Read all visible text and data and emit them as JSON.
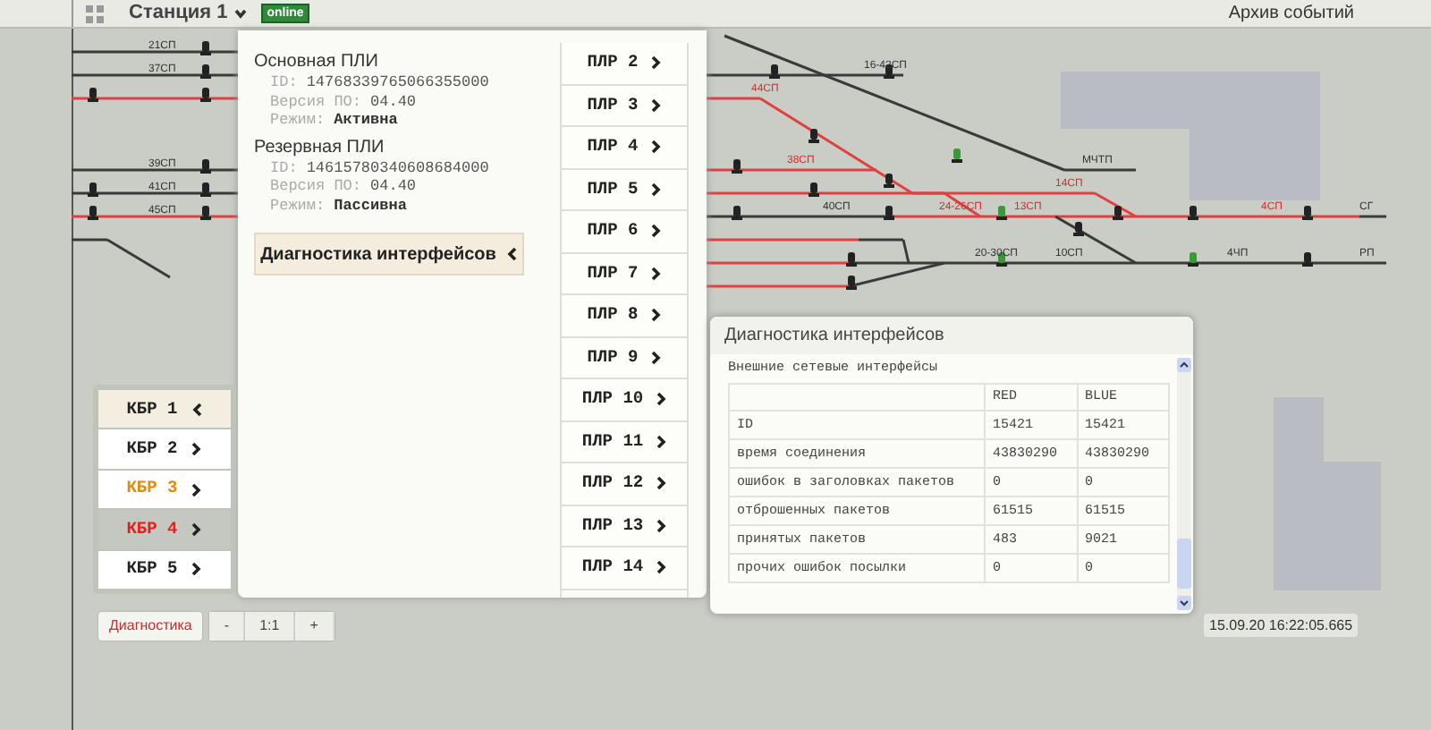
{
  "topbar": {
    "station": "Станция 1",
    "status": "online",
    "archive": "Архив событий"
  },
  "track_labels": [
    {
      "text": "21СП",
      "color": "#333333"
    },
    {
      "text": "37СП",
      "color": "#333333"
    },
    {
      "text": "39СП",
      "color": "#333333"
    },
    {
      "text": "41СП",
      "color": "#333333"
    },
    {
      "text": "45СП",
      "color": "#333333"
    },
    {
      "text": "44СП",
      "color": "#d03030"
    },
    {
      "text": "16-42СП",
      "color": "#333333"
    },
    {
      "text": "38СП",
      "color": "#d03030"
    },
    {
      "text": "МЧТП",
      "color": "#333333"
    },
    {
      "text": "14СП",
      "color": "#d03030"
    },
    {
      "text": "40СП",
      "color": "#333333"
    },
    {
      "text": "24-26СП",
      "color": "#d03030"
    },
    {
      "text": "13СП",
      "color": "#d03030"
    },
    {
      "text": "4СП",
      "color": "#d03030"
    },
    {
      "text": "СГ",
      "color": "#333333"
    },
    {
      "text": "20-30СП",
      "color": "#333333"
    },
    {
      "text": "10СП",
      "color": "#333333"
    },
    {
      "text": "4ЧП",
      "color": "#333333"
    },
    {
      "text": "РП",
      "color": "#333333"
    }
  ],
  "controller_panel": {
    "units": [
      {
        "title": "Основная ПЛИ",
        "id_label": "ID:",
        "id": "14768339765066355000",
        "version_label": "Версия ПО:",
        "version": "04.40",
        "mode_label": "Режим:",
        "mode": "Активна"
      },
      {
        "title": "Резервная ПЛИ",
        "id_label": "ID:",
        "id": "14615780340608684000",
        "version_label": "Версия ПО:",
        "version": "04.40",
        "mode_label": "Режим:",
        "mode": "Пассивна"
      }
    ],
    "diagnostics_button": {
      "label": "Диагностика интерфейсов",
      "expanded": true
    },
    "plr": [
      {
        "label": "ПЛР 2"
      },
      {
        "label": "ПЛР 3"
      },
      {
        "label": "ПЛР 4"
      },
      {
        "label": "ПЛР 5"
      },
      {
        "label": "ПЛР 6"
      },
      {
        "label": "ПЛР 7"
      },
      {
        "label": "ПЛР 8"
      },
      {
        "label": "ПЛР 9"
      },
      {
        "label": "ПЛР 10"
      },
      {
        "label": "ПЛР 11"
      },
      {
        "label": "ПЛР 12"
      },
      {
        "label": "ПЛР 13"
      },
      {
        "label": "ПЛР 14"
      }
    ]
  },
  "kbr": [
    {
      "label": "КБР 1",
      "selected": true,
      "shaded": false,
      "color": "#222222"
    },
    {
      "label": "КБР 2",
      "selected": false,
      "shaded": false,
      "color": "#222222"
    },
    {
      "label": "КБР 3",
      "selected": false,
      "shaded": false,
      "color": "#e08a10"
    },
    {
      "label": "КБР 4",
      "selected": false,
      "shaded": true,
      "color": "#e02020"
    },
    {
      "label": "КБР 5",
      "selected": false,
      "shaded": false,
      "color": "#222222"
    }
  ],
  "dialog": {
    "title": "Диагностика интерфейсов",
    "section": "Внешние сетевые интерфейсы",
    "columns": [
      "RED",
      "BLUE"
    ],
    "rows": [
      {
        "name": "ID",
        "values": [
          "15421",
          "15421"
        ]
      },
      {
        "name": "время соединения",
        "values": [
          "43830290",
          "43830290"
        ]
      },
      {
        "name": "ошибок в заголовках пакетов",
        "values": [
          "0",
          "0"
        ]
      },
      {
        "name": "отброшенных пакетов",
        "values": [
          "61515",
          "61515"
        ]
      },
      {
        "name": "принятых пакетов",
        "values": [
          "483",
          "9021"
        ]
      },
      {
        "name": "прочих ошибок посылки",
        "values": [
          "0",
          "0"
        ]
      }
    ]
  },
  "bottom": {
    "diagnostics": "Диагностика",
    "zoom": [
      "-",
      "1:1",
      "+"
    ]
  },
  "timestamp": "15.09.20 16:22:05.665"
}
